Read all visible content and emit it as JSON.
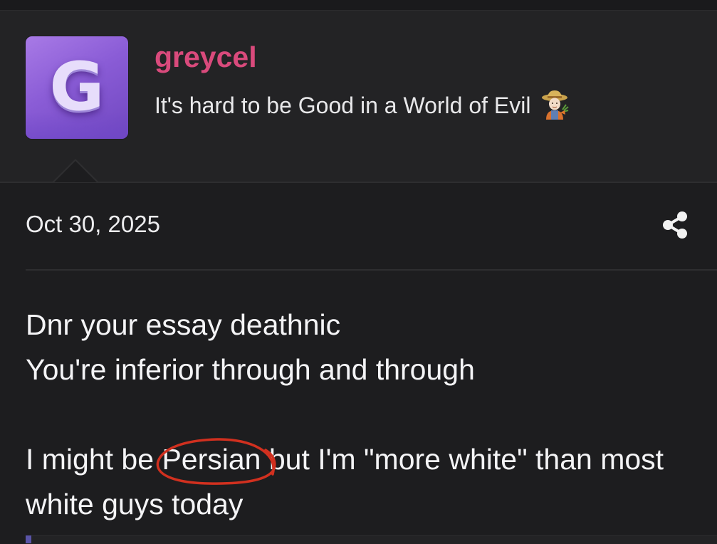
{
  "user": {
    "avatar_letter": "G",
    "username": "greycel",
    "title": "It's hard to be Good in a World of Evil",
    "title_emoji": "farmer-emoji"
  },
  "post": {
    "date": "Oct 30, 2025",
    "share_icon": "share-icon",
    "lines": [
      "Dnr your essay deathnic",
      "You're inferior through and through",
      "",
      "white guys today"
    ],
    "line3_before": "I might be ",
    "line3_circled": "Persian",
    "line3_after": " but I'm \"more white\" than most"
  },
  "colors": {
    "background": "#1d1d1f",
    "header_background": "#232325",
    "username": "#d94a7c",
    "circle_annotation": "#d1301f",
    "avatar_gradient_start": "#a87ae6",
    "avatar_gradient_end": "#7047c0"
  }
}
